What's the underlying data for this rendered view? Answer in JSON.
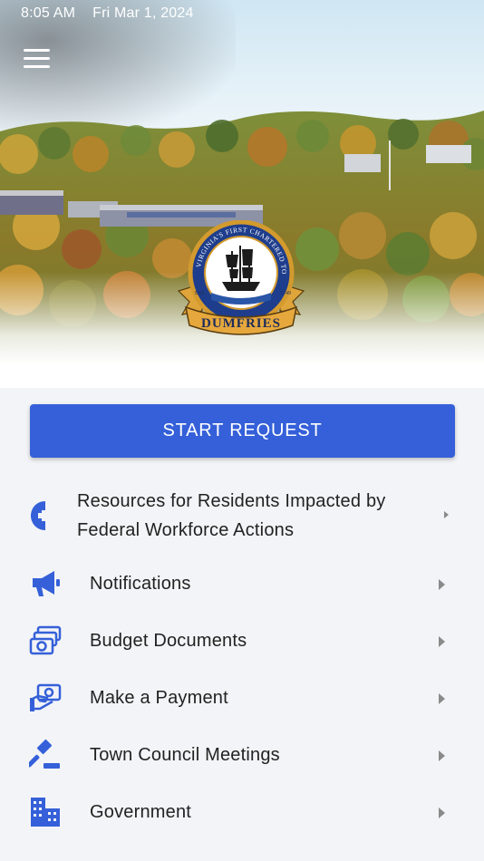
{
  "status_bar": {
    "time": "8:05 AM",
    "date": "Fri Mar 1, 2024"
  },
  "header": {
    "menu_icon": "hamburger-menu-icon",
    "logo": "town-of-dumfries-seal"
  },
  "start_request": {
    "label": "START REQUEST"
  },
  "menu_items": [
    {
      "label": "Resources for Residents Impacted by Federal Workforce Actions",
      "icon": "plus-shield-icon"
    },
    {
      "label": "Notifications",
      "icon": "megaphone-icon"
    },
    {
      "label": "Budget Documents",
      "icon": "money-stack-icon"
    },
    {
      "label": "Make a Payment",
      "icon": "hand-payment-icon"
    },
    {
      "label": "Town Council Meetings",
      "icon": "gavel-icon"
    },
    {
      "label": "Government",
      "icon": "city-buildings-icon"
    }
  ],
  "colors": {
    "accent": "#3560d9",
    "icon": "#3560d9",
    "chevron": "#8a8a8a"
  }
}
